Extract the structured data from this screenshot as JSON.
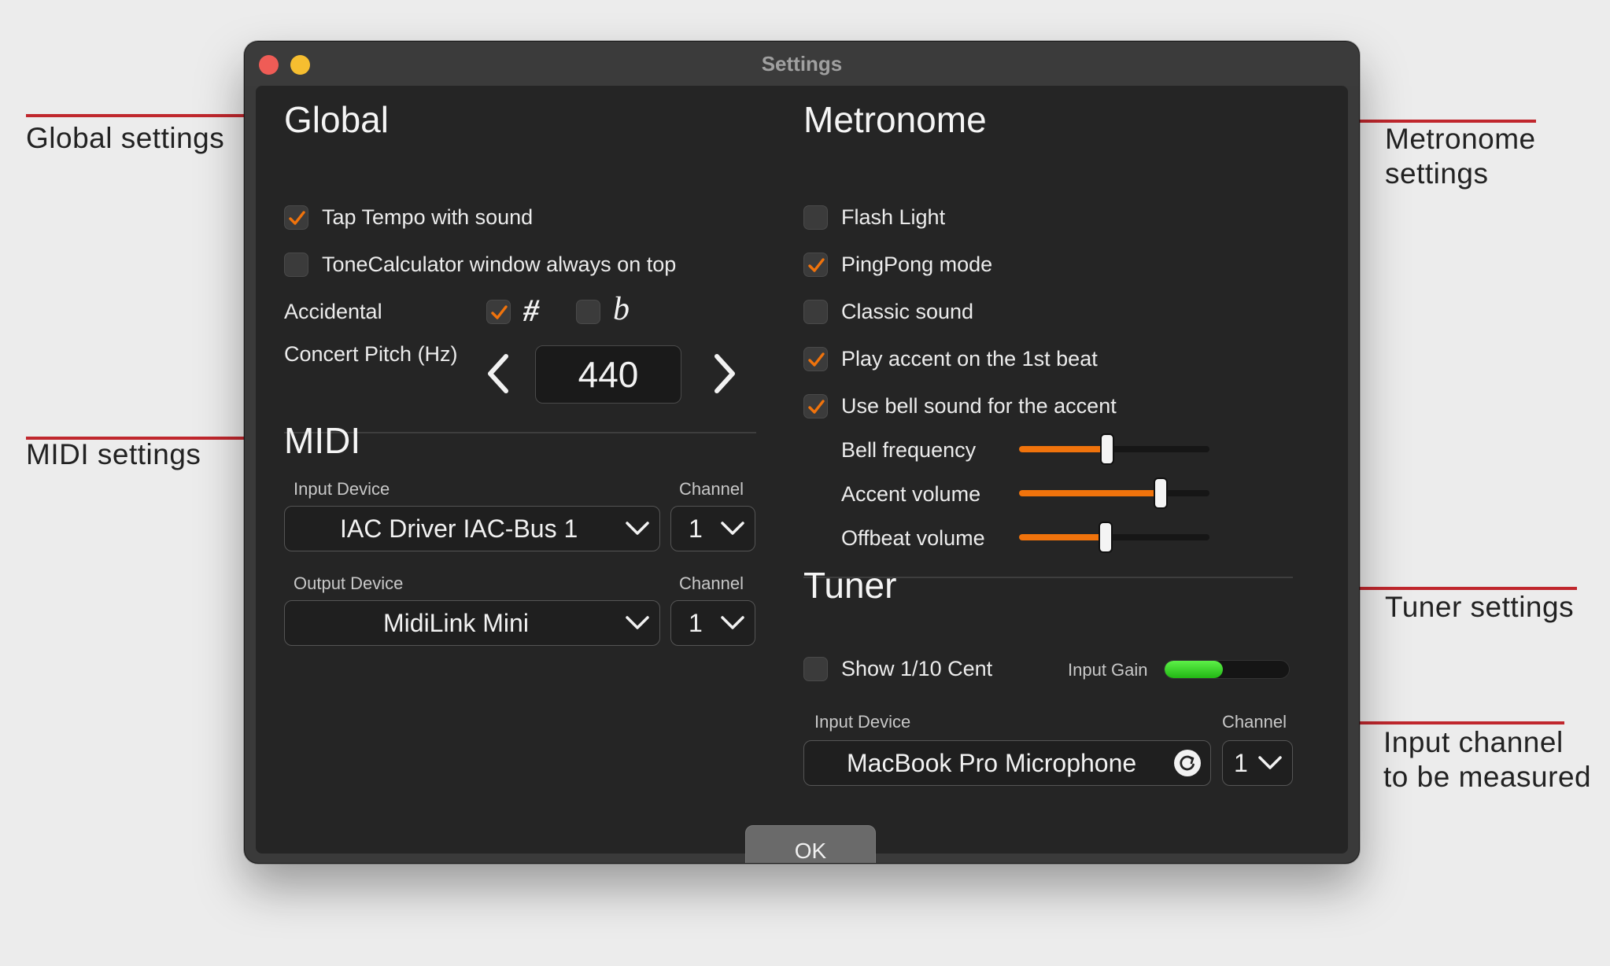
{
  "annotations": {
    "global": "Global settings",
    "midi": "MIDI settings",
    "metronome": "Metronome\nsettings",
    "tuner": "Tuner settings",
    "input_channel": "Input channel\nto be measured"
  },
  "window": {
    "title": "Settings"
  },
  "global": {
    "heading": "Global",
    "tap_tempo": {
      "label": "Tap Tempo with sound",
      "checked": true
    },
    "always_on_top": {
      "label": "ToneCalculator window always on top",
      "checked": false
    },
    "accidental_label": "Accidental",
    "sharp": {
      "symbol": "#",
      "checked": true
    },
    "flat": {
      "symbol": "b",
      "checked": false
    },
    "concert_pitch_label": "Concert Pitch (Hz)",
    "concert_pitch_value": "440"
  },
  "midi": {
    "heading": "MIDI",
    "input_device_label": "Input Device",
    "input_device_value": "IAC Driver IAC-Bus 1",
    "input_channel_label": "Channel",
    "input_channel_value": "1",
    "output_device_label": "Output Device",
    "output_device_value": "MidiLink Mini",
    "output_channel_label": "Channel",
    "output_channel_value": "1"
  },
  "metronome": {
    "heading": "Metronome",
    "flash_light": {
      "label": "Flash Light",
      "checked": false
    },
    "pingpong": {
      "label": "PingPong mode",
      "checked": true
    },
    "classic_sound": {
      "label": "Classic sound",
      "checked": false
    },
    "accent_first": {
      "label": "Play accent on the 1st beat",
      "checked": true
    },
    "bell_accent": {
      "label": "Use bell sound for the accent",
      "checked": true
    },
    "bell_frequency": {
      "label": "Bell frequency",
      "level": 0.46
    },
    "accent_volume": {
      "label": "Accent volume",
      "level": 0.74
    },
    "offbeat_volume": {
      "label": "Offbeat volume",
      "level": 0.45
    }
  },
  "tuner": {
    "heading": "Tuner",
    "show_tenth_cent": {
      "label": "Show 1/10 Cent",
      "checked": false
    },
    "input_gain_label": "Input Gain",
    "input_gain_level": 0.47,
    "input_device_label": "Input Device",
    "input_device_value": "MacBook Pro Microphone",
    "channel_label": "Channel",
    "channel_value": "1"
  },
  "buttons": {
    "ok": "OK"
  },
  "colors": {
    "accent": "#f0730c",
    "gain": "#3dd62a",
    "annotation_line": "#c0272d"
  }
}
